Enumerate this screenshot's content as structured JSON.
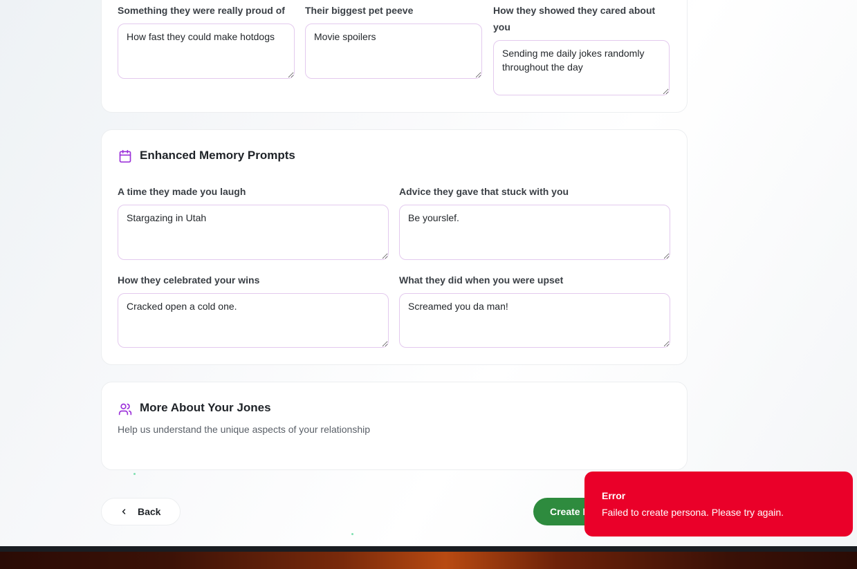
{
  "relationship_card": {
    "fields": [
      {
        "label": "Something they were really proud of",
        "value": "How fast they could make hotdogs"
      },
      {
        "label": "Their biggest pet peeve",
        "value": "Movie spoilers"
      },
      {
        "label": "How they showed they cared about you",
        "value": "Sending me daily jokes randomly throughout the day"
      }
    ]
  },
  "enhanced_memory": {
    "title": "Enhanced Memory Prompts",
    "icon": "calendar-icon",
    "fields": [
      {
        "label": "A time they made you laugh",
        "value": "Stargazing in Utah"
      },
      {
        "label": "Advice they gave that stuck with you",
        "value": "Be yourslef."
      },
      {
        "label": "How they celebrated your wins",
        "value": "Cracked open a cold one."
      },
      {
        "label": "What they did when you were upset",
        "value": "Screamed you da man!"
      }
    ]
  },
  "more_about": {
    "title": "More About Your Jones",
    "icon": "users-icon",
    "subtitle": "Help us understand the unique aspects of your relationship"
  },
  "actions": {
    "back_label": "Back",
    "create_label": "Create Persona"
  },
  "toast": {
    "title": "Error",
    "message": "Failed to create persona. Please try again."
  },
  "colors": {
    "accent": "#9b30d9",
    "create_button": "#2e8b3e",
    "error": "#ea0029"
  }
}
